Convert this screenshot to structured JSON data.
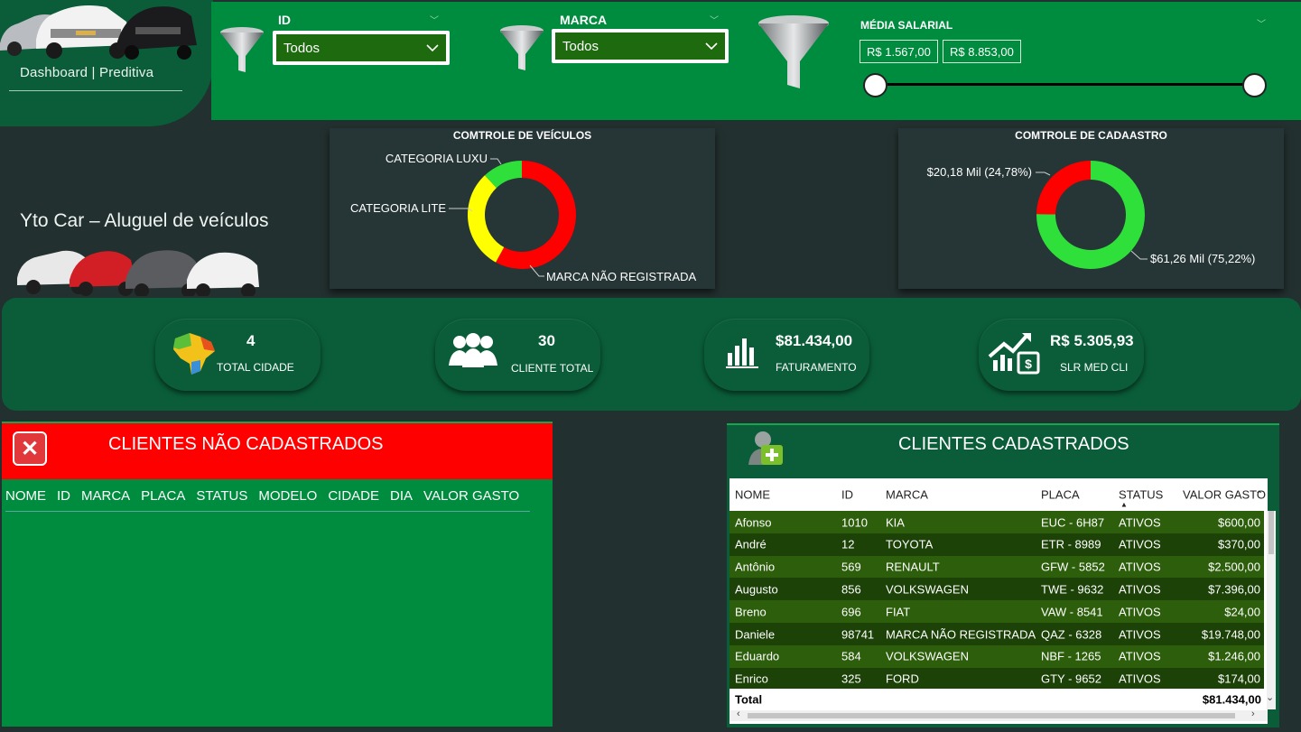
{
  "app": {
    "nav_label": "Dashboard | Preditiva",
    "brand_title": "Yto Car – Aluguel de veículos"
  },
  "filters": {
    "id": {
      "label": "ID",
      "value": "Todos"
    },
    "marca": {
      "label": "MARCA",
      "value": "Todos"
    },
    "salario": {
      "label": "MÉDIA SALARIAL",
      "min_value": "R$ 1.567,00",
      "max_value": "R$ 8.853,00",
      "range_fraction": [
        0,
        1
      ]
    }
  },
  "charts": {
    "veiculos": {
      "title": "COMTROLE DE VEÍCULOS"
    },
    "cadastro": {
      "title": "COMTROLE DE CADAASTRO"
    }
  },
  "chart_data": [
    {
      "type": "pie",
      "title": "COMTROLE DE VEÍCULOS",
      "donut": true,
      "labels": [
        "MARCA NÃO REGISTRADA",
        "CATEGORIA LITE",
        "CATEGORIA LUXU"
      ],
      "values": [
        58,
        30,
        12
      ],
      "colors": [
        "#ff0000",
        "#ffff00",
        "#2fe03a"
      ]
    },
    {
      "type": "pie",
      "title": "COMTROLE DE CADAASTRO",
      "donut": true,
      "labels": [
        "$61,26 Mil (75,22%)",
        "$20,18 Mil (24,78%)"
      ],
      "values": [
        75.22,
        24.78
      ],
      "colors": [
        "#2fe03a",
        "#ff0000"
      ]
    }
  ],
  "kpis": [
    {
      "value": "4",
      "label": "TOTAL CIDADE",
      "icon": "brazil-map-icon"
    },
    {
      "value": "30",
      "label": "CLIENTE TOTAL",
      "icon": "people-icon"
    },
    {
      "value": "$81.434,00",
      "label": "FATURAMENTO",
      "icon": "bar-chart-icon"
    },
    {
      "value": "R$ 5.305,93",
      "label": "SLR MED CLI",
      "icon": "growth-money-icon"
    }
  ],
  "nao_cadastrados": {
    "title": "CLIENTES NÃO CADASTRADOS",
    "columns": [
      "NOME",
      "ID",
      "MARCA",
      "PLACA",
      "STATUS",
      "MODELO",
      "CIDADE",
      "DIA",
      "VALOR GASTO"
    ]
  },
  "cadastrados": {
    "title": "CLIENTES CADASTRADOS",
    "columns": [
      "NOME",
      "ID",
      "MARCA",
      "PLACA",
      "STATUS",
      "VALOR GASTO"
    ],
    "rows": [
      [
        "Afonso",
        "1010",
        "KIA",
        "EUC - 6H87",
        "ATIVOS",
        "$600,00"
      ],
      [
        "André",
        "12",
        "TOYOTA",
        "ETR - 8989",
        "ATIVOS",
        "$370,00"
      ],
      [
        "Antônio",
        "569",
        "RENAULT",
        "GFW - 5852",
        "ATIVOS",
        "$2.500,00"
      ],
      [
        "Augusto",
        "856",
        "VOLKSWAGEN",
        "TWE - 9632",
        "ATIVOS",
        "$7.396,00"
      ],
      [
        "Breno",
        "696",
        "FIAT",
        "VAW - 8541",
        "ATIVOS",
        "$24,00"
      ],
      [
        "Daniele",
        "98741",
        "MARCA NÃO REGISTRADA",
        "QAZ - 6328",
        "ATIVOS",
        "$19.748,00"
      ],
      [
        "Eduardo",
        "584",
        "VOLKSWAGEN",
        "NBF - 1265",
        "ATIVOS",
        "$1.246,00"
      ],
      [
        "Enrico",
        "325",
        "FORD",
        "GTY - 9652",
        "ATIVOS",
        "$174,00"
      ]
    ],
    "total_label": "Total",
    "total_value": "$81.434,00"
  },
  "colors": {
    "accent_green": "#008c3e",
    "dark_green": "#0a5d38",
    "background": "#22302f",
    "alert_red": "#ff0000"
  }
}
